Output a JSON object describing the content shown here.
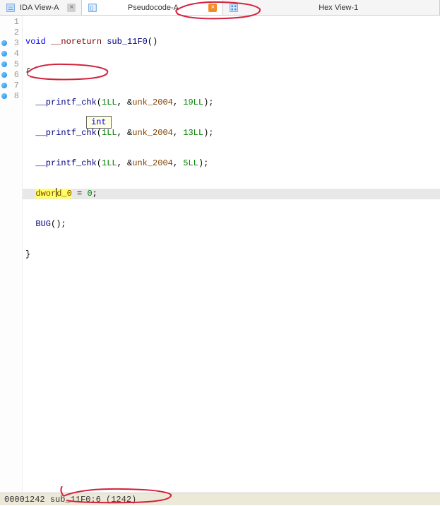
{
  "tabs": [
    {
      "label": "IDA View-A",
      "active": false,
      "close_style": "gray"
    },
    {
      "label": "Pseudocode-A",
      "active": true,
      "close_style": "orange"
    },
    {
      "label": "Hex View-1",
      "active": false,
      "close_style": "none"
    }
  ],
  "gutter": {
    "lines": [
      "1",
      "2",
      "3",
      "4",
      "5",
      "6",
      "7",
      "8"
    ],
    "breakpoints": [
      3,
      4,
      5,
      6,
      7,
      8
    ]
  },
  "code": {
    "l1_kw_void": "void",
    "l1_noret": "__noreturn",
    "l1_fn": "sub_11F0",
    "l1_tail": "()",
    "l2": "{",
    "l3_fn": "__printf_chk",
    "l3_args_open": "(",
    "l3_n1": "1LL",
    "l3_sep": ", &",
    "l3_unk": "unk_2004",
    "l3_sep2": ", ",
    "l3_n2": "19LL",
    "l3_close": ");",
    "l4_fn": "__printf_chk",
    "l4_n2": "13LL",
    "l5_fn": "__printf_chk",
    "l5_n2": "5LL",
    "l6_dword_a": "dwor",
    "l6_dword_b": "d",
    "l6_dword_c": "_0",
    "l6_assign": " = ",
    "l6_zero": "0",
    "l6_semi": ";",
    "l7_bug": "BUG",
    "l7_tail": "();",
    "l8": "}"
  },
  "hint": {
    "text": "int"
  },
  "status": {
    "addr": "00001242",
    "loc": "sub_11F0:6 (1242)"
  }
}
